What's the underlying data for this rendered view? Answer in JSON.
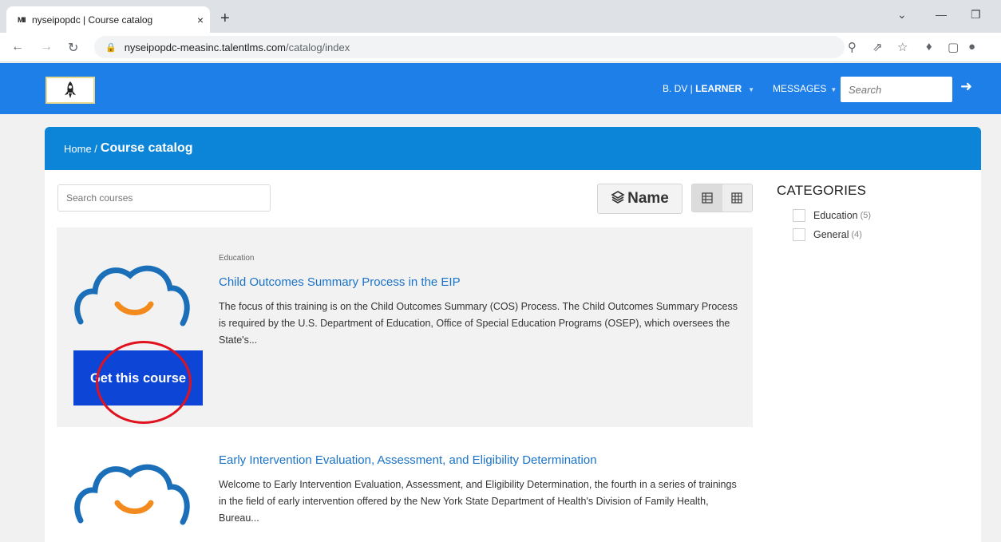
{
  "browser": {
    "tab_favicon": "MII",
    "tab_title": "nyseipopdc | Course catalog",
    "tab_close": "×",
    "new_tab": "+",
    "url_main": "nyseipopdc-measinc.talentlms.com",
    "url_path": "/catalog/index"
  },
  "header": {
    "user_name": "B. DV | ",
    "user_role": "LEARNER",
    "messages": "MESSAGES",
    "search_placeholder": "Search"
  },
  "breadcrumb": {
    "home": "Home /",
    "current": "Course catalog"
  },
  "toolbar": {
    "search_placeholder": "Search courses",
    "sort_label": "Name"
  },
  "courses": [
    {
      "category": "Education",
      "title": "Child Outcomes Summary Process in the EIP",
      "description": "The focus of this training is on the Child Outcomes Summary (COS) Process. The Child Outcomes Summary Process is required by the U.S. Department of Education, Office of Special Education Programs (OSEP), which oversees the State's...",
      "button": "Get this course"
    },
    {
      "title": "Early Intervention Evaluation, Assessment, and Eligibility Determination",
      "description": "Welcome to Early Intervention Evaluation, Assessment, and Eligibility Determination, the fourth in a series of trainings in the field of early intervention offered by the New York State Department of Health's Division of Family Health, Bureau..."
    }
  ],
  "categories": {
    "title": "CATEGORIES",
    "items": [
      {
        "name": "Education",
        "count": "(5)"
      },
      {
        "name": "General",
        "count": "(4)"
      }
    ]
  },
  "colors": {
    "header_blue": "#1e7fe8",
    "card_head_blue": "#0c85d8",
    "button_blue": "#0d45d6",
    "cloud_blue": "#1a6fb8",
    "smile_orange": "#f28a1e",
    "annotation_red": "#e0121e"
  }
}
